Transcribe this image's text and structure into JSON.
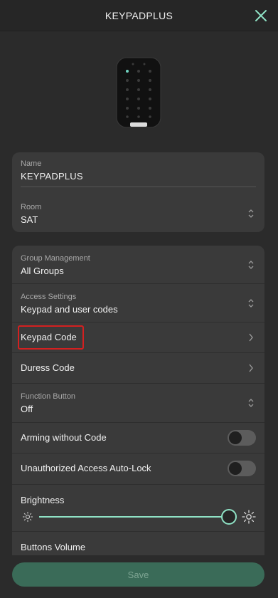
{
  "header": {
    "title": "KEYPADPLUS"
  },
  "name_card": {
    "name_label": "Name",
    "name_value": "KEYPADPLUS",
    "room_label": "Room",
    "room_value": "SAT"
  },
  "settings": {
    "group_label": "Group Management",
    "group_value": "All Groups",
    "access_label": "Access Settings",
    "access_value": "Keypad and user codes",
    "keypad_code": "Keypad Code",
    "duress_code": "Duress Code",
    "function_label": "Function Button",
    "function_value": "Off",
    "arming_without_code": "Arming without Code",
    "auto_lock": "Unauthorized Access Auto-Lock",
    "brightness_label": "Brightness",
    "brightness_level": 1.0,
    "volume_label": "Buttons Volume"
  },
  "toggles": {
    "arming_without_code": false,
    "auto_lock": false
  },
  "footer": {
    "save_label": "Save"
  },
  "colors": {
    "accent": "#8fe2c5",
    "highlight": "#d42020",
    "save_button": "#3a6b58"
  }
}
